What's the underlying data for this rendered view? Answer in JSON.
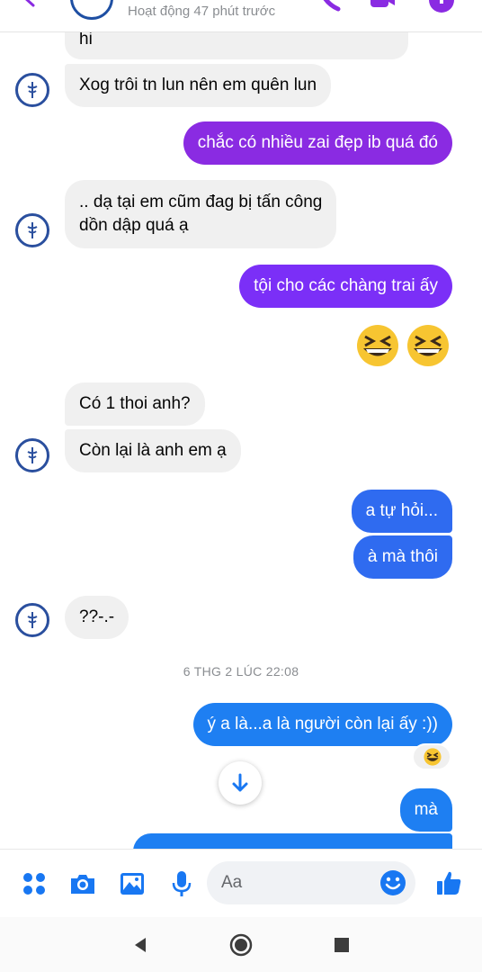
{
  "header": {
    "status": "Hoạt động 47 phút trước",
    "icons": [
      "back-arrow-icon",
      "phone-icon",
      "video-camera-icon",
      "info-icon"
    ],
    "accent": "#8a2be2"
  },
  "messages": [
    {
      "id": "m1",
      "side": "in",
      "text": "hi"
    },
    {
      "id": "m2",
      "side": "in",
      "text": "Xog trôi tn lun nên em quên lun"
    },
    {
      "id": "m3",
      "side": "out",
      "text": "chắc có nhiều zai đẹp ib quá đó"
    },
    {
      "id": "m4",
      "side": "in",
      "text": ".. dạ tại em cũm đag bị tấn công",
      "text2": "dồn dập quá ạ"
    },
    {
      "id": "m5",
      "side": "out",
      "text": "tội cho các chàng trai ấy"
    },
    {
      "id": "m6",
      "side": "out",
      "emoji": "grinning-squinting-face x2"
    },
    {
      "id": "m7",
      "side": "in",
      "text": "Có 1 thoi anh?"
    },
    {
      "id": "m8",
      "side": "in",
      "text": "Còn lại là anh em ạ"
    },
    {
      "id": "m9",
      "side": "out",
      "text": "a tự hỏi..."
    },
    {
      "id": "m10",
      "side": "out",
      "text": "à mà thôi"
    },
    {
      "id": "m11",
      "side": "in",
      "text": "??-.-"
    },
    {
      "id": "m12",
      "side": "out",
      "text": "ý a là...a là người còn lại ấy :))",
      "reaction": "😆"
    },
    {
      "id": "m13",
      "side": "out",
      "text": "mà"
    }
  ],
  "timestamp": "6 THG 2 LÚC 22:08",
  "composer": {
    "placeholder": "Aa",
    "icons": [
      "menu-dots-icon",
      "camera-icon",
      "gallery-icon",
      "microphone-icon",
      "emoji-icon",
      "like-thumb-icon"
    ],
    "accent": "#1877f2"
  },
  "navbar": {
    "icons": [
      "nav-back-icon",
      "nav-home-icon",
      "nav-recents-icon"
    ]
  }
}
